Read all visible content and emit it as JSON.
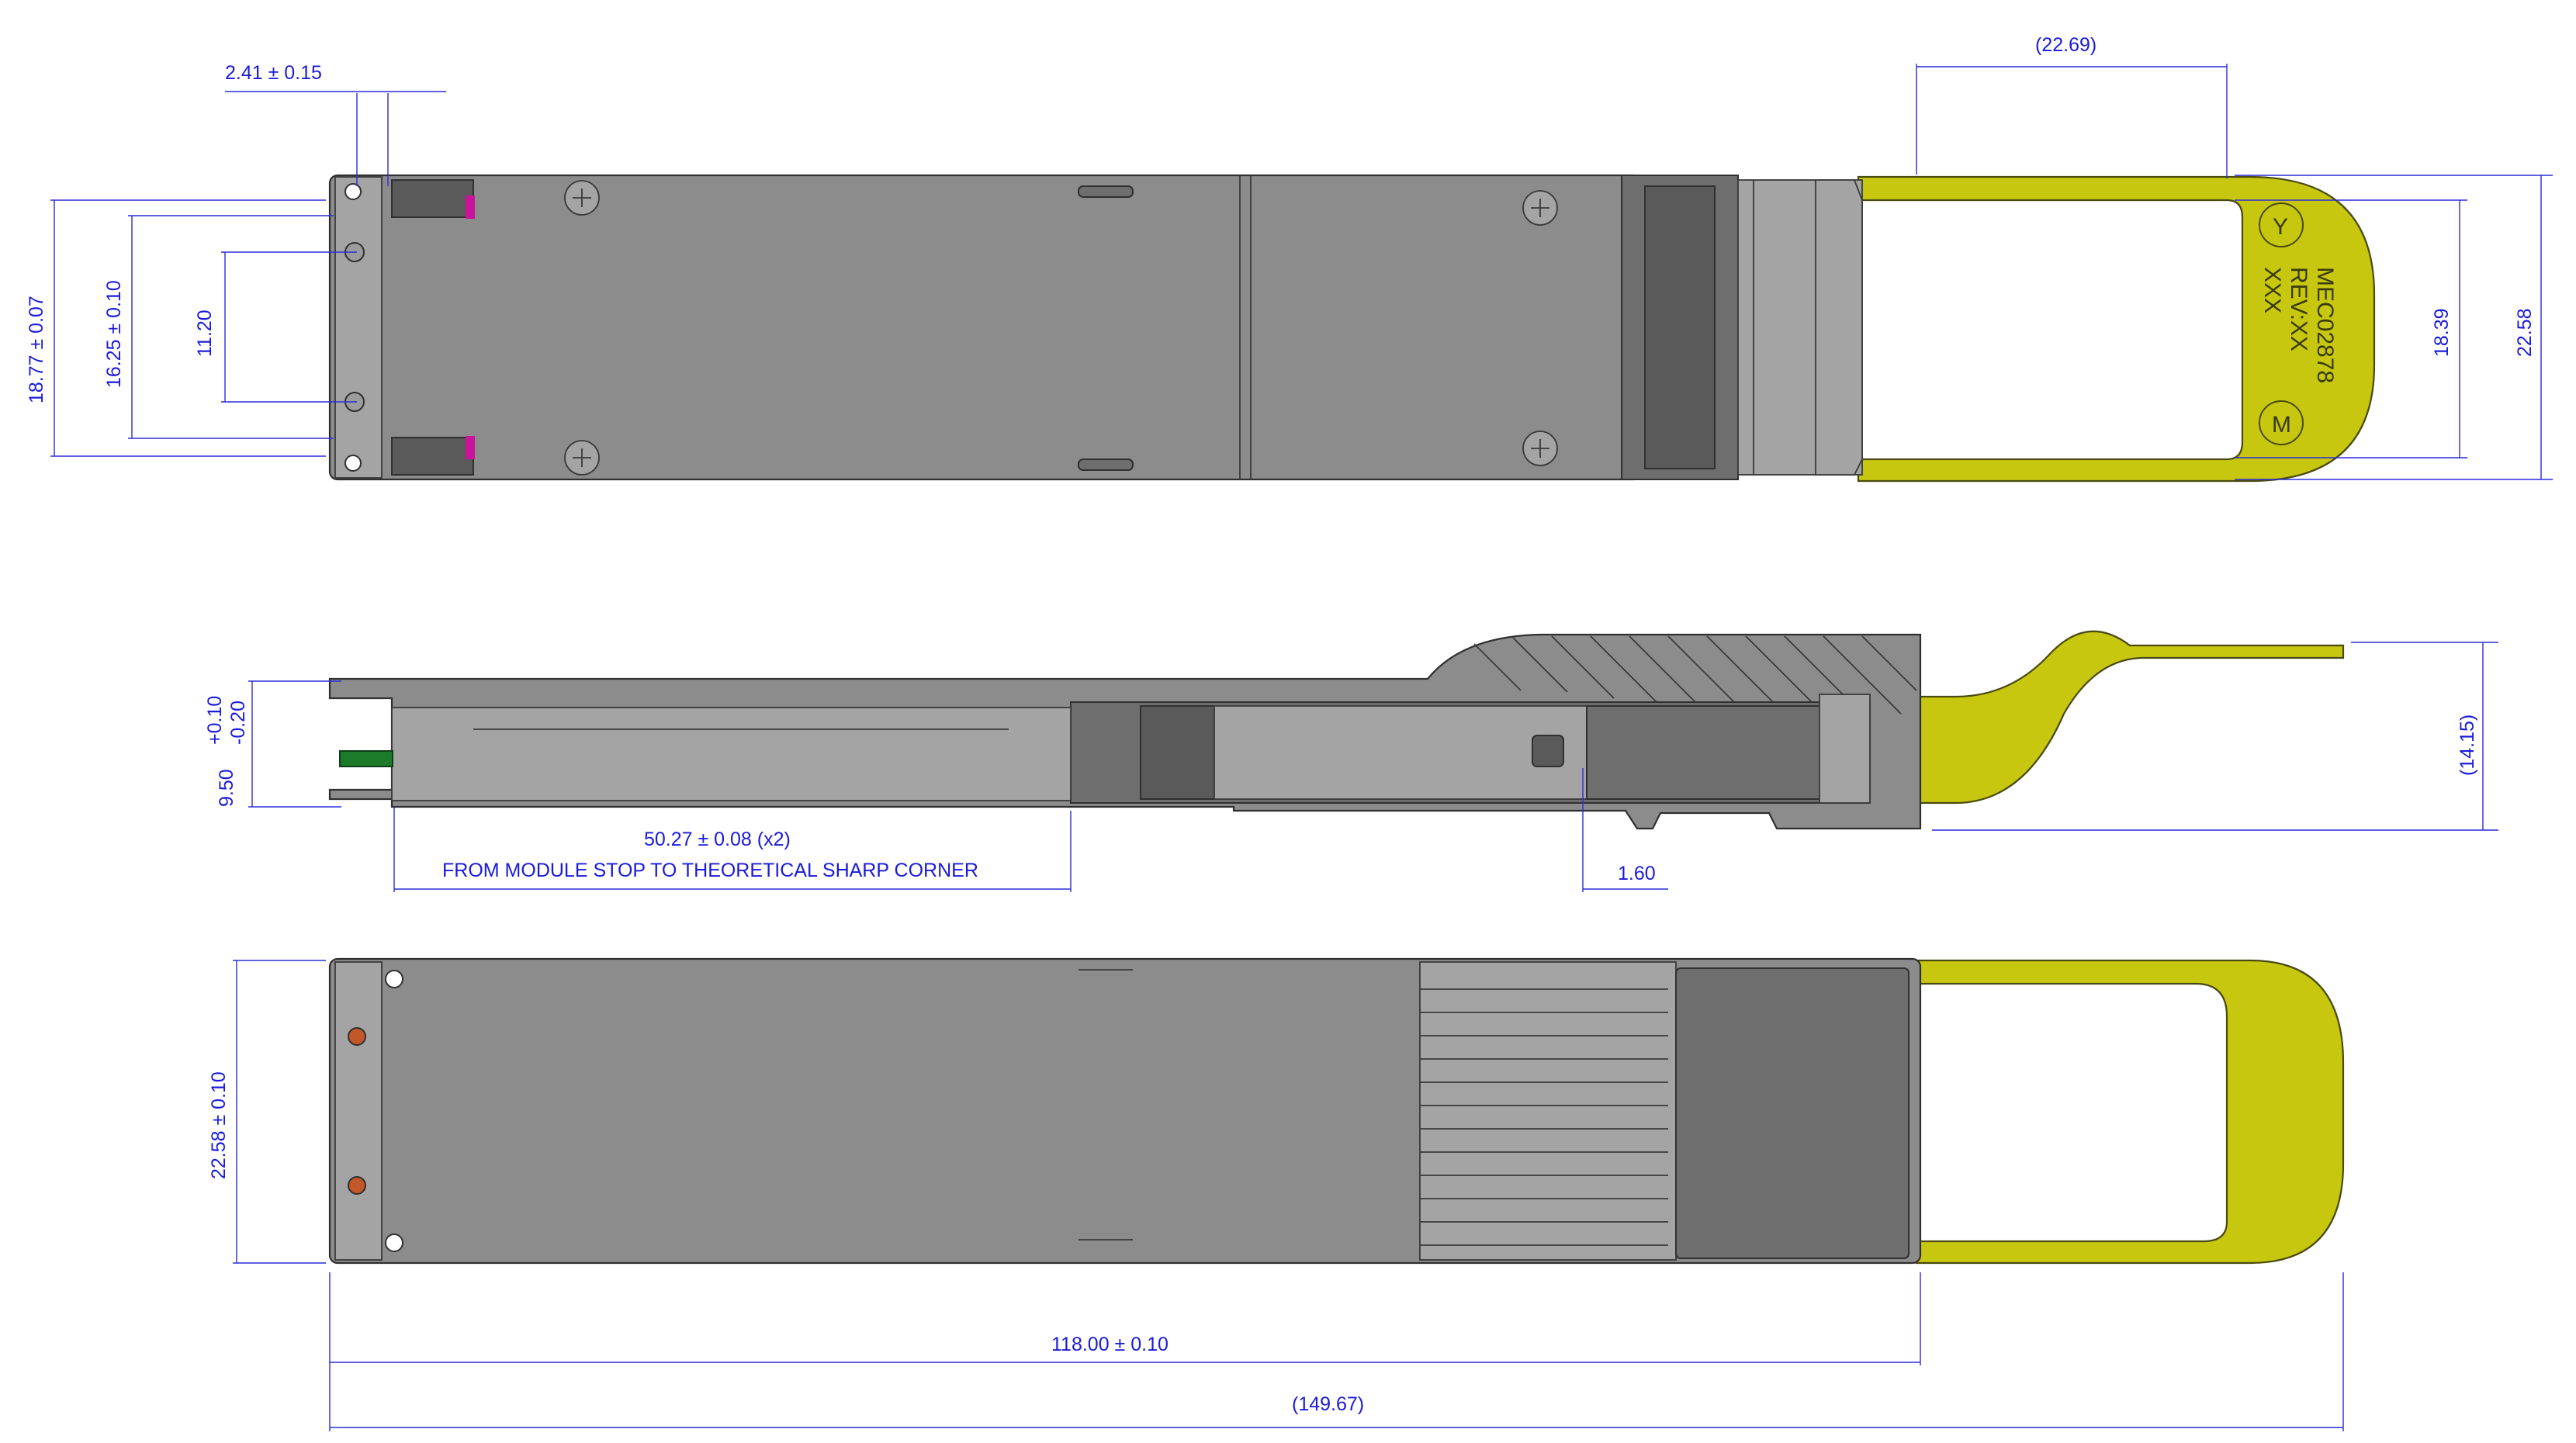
{
  "drawing": {
    "top_view": {
      "dim_slot_width": "2.41 ± 0.15",
      "dim_pull_tab_length": "(22.69)",
      "dim_height_outer": "18.77 ± 0.07",
      "dim_height_inner": "16.25 ± 0.10",
      "dim_hole_spacing": "11.20",
      "dim_tab_inner": "18.39",
      "dim_tab_outer": "22.58",
      "tab_marking_line1": "MEC02878",
      "tab_marking_line2": "REV:XX",
      "tab_marking_line3": "XXX",
      "tab_logo_top": "Y",
      "tab_logo_bottom": "M"
    },
    "side_view": {
      "dim_thickness": "9.50",
      "dim_thickness_tol_plus": "+0.10",
      "dim_thickness_tol_minus": "-0.20",
      "dim_stop_distance": "50.27 ± 0.08 (x2)",
      "dim_stop_note": "FROM MODULE STOP TO THEORETICAL SHARP CORNER",
      "dim_latch_offset": "1.60",
      "dim_total_height": "(14.15)"
    },
    "bottom_view": {
      "dim_width": "22.58 ± 0.10",
      "dim_body_length": "118.00 ± 0.10",
      "dim_total_length": "(149.67)"
    }
  }
}
